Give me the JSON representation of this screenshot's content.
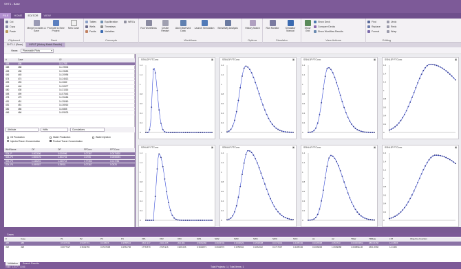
{
  "app": {
    "title": "SHT1 - Base"
  },
  "menu_tabs": [
    "FILE",
    "HOME",
    "EDITOR",
    "VIEW"
  ],
  "ribbon": {
    "clipboard": {
      "label": "Clipboard",
      "cut": "Cut",
      "copy": "Copy",
      "paste": "Paste"
    },
    "deck": {
      "label": "Deck",
      "merge": "Merge Includes & Save",
      "promote": "Promote to New Project",
      "new_case": "New Case"
    },
    "concepts": {
      "label": "Concepts",
      "tables": "Tables",
      "wells": "Wells",
      "faults": "Faults",
      "equilibration": "Equilibration",
      "timesteps": "Timesteps",
      "variables": "Variables",
      "wrcs": "WRCs"
    },
    "workflows": {
      "label": "Workflows",
      "run": "Run Workflows",
      "create": "Create Restart",
      "add_observed": "Add Observed Data",
      "launch": "Launch Simulation",
      "sensitivity": "Sensitivity Analysis"
    },
    "optima": {
      "label": "Optima",
      "history": "History Match"
    },
    "simulator": {
      "label": "Simulator",
      "run_monitor": "Run Monitor",
      "sim_manual": "Simulator Manual"
    },
    "view_actions": {
      "label": "View Actions",
      "show_grid": "Show Grid",
      "show_deck": "Show Deck",
      "compare": "Compare Decks",
      "show_results": "Show Workflow Results"
    },
    "editing": {
      "label": "Editing",
      "find": "Find",
      "replace": "Replace",
      "format": "Format",
      "undo": "Undo",
      "redo": "Redo",
      "wrap": "Wrap"
    }
  },
  "doc_tabs": [
    "SHT1-1 (Base)",
    "INPUT (History Match Results)"
  ],
  "views": {
    "label": "Views:",
    "value": "Plasmatch Plots"
  },
  "grid": {
    "headers": [
      "#",
      "Case",
      "Of"
    ],
    "rows": [
      [
        "498",
        "498",
        "14.4785"
      ],
      [
        "488",
        "488",
        "14.19506"
      ],
      [
        "498",
        "498",
        "14.19653"
      ],
      [
        "446",
        "445",
        "14.20996"
      ],
      [
        "474",
        "474",
        "14.24613"
      ],
      [
        "493",
        "493",
        "14.2682"
      ],
      [
        "446",
        "446",
        "14.30577"
      ],
      [
        "450",
        "430",
        "14.31316"
      ],
      [
        "498",
        "499",
        "14.57543"
      ],
      [
        "478",
        "479",
        "14.35486"
      ],
      [
        "451",
        "451",
        "14.35060"
      ],
      [
        "451",
        "451",
        "14.36916"
      ],
      [
        "486",
        "486",
        "14.5885"
      ],
      [
        "466",
        "466",
        "14.59003"
      ]
    ]
  },
  "filters": {
    "a": "Attribute",
    "b": "Hdfts",
    "c": "Cumulatives"
  },
  "checks": {
    "oil": "Oil Production",
    "water": "Water Production",
    "winj": "Water Injection",
    "inj_tracer": "Injected Tracer Concentration",
    "prod_tracer": "Product Tracer Concentration"
  },
  "wells": {
    "headers": [
      "Well Name",
      "OF",
      "OP",
      "FPConc",
      "FPTConc"
    ],
    "rows": [
      [
        "SDL-P",
        "0.002606",
        "0.006996",
        "0.07367",
        "0.0075520"
      ],
      [
        "SDL-P2",
        "1.000176",
        "1.402716",
        "1.0705",
        "0.0055094"
      ],
      [
        "SDL-P3",
        "1.448251",
        "1.445712",
        "1.77356",
        "0.017256"
      ],
      [
        "SDL-P4",
        "0.499557",
        "0.29901",
        "0.07367",
        "0.0025"
      ]
    ]
  },
  "plots": [
    {
      "title": "SSNL2P FTConc"
    },
    {
      "title": "SSNL3P FTConc"
    },
    {
      "title": "SSNL3P FTConc"
    },
    {
      "title": "SSNL3P FTConc"
    },
    {
      "title": "SSNL4P FTConc"
    },
    {
      "title": "SSNL4P FTConc"
    },
    {
      "title": "SSNL4P FTConc"
    },
    {
      "title": "SSNL3P FTConc"
    }
  ],
  "y_ticks_a": [
    "0",
    "0.2",
    "0.4",
    "0.6",
    "0.8",
    "1",
    "1.2",
    "1.4"
  ],
  "y_ticks_b": [
    "0",
    "0.2",
    "0.4",
    "0.6",
    "0.8",
    "1",
    "1.2",
    "1.4",
    "1.6"
  ],
  "cases": {
    "title": "Cases",
    "headers": [
      "#",
      "Case",
      "P1",
      "P2",
      "P3",
      "P4",
      "VP1",
      "VP2",
      "VP3",
      "SW1",
      "SW2",
      "SW3",
      "SW4",
      "SWC",
      "SOC",
      "A1",
      "A2",
      "TRatr",
      "TRRate",
      "LTZ",
      "Objective Function"
    ],
    "rows": [
      [
        "488",
        "488",
        "0.5467219",
        "0.5467719",
        "0.348526",
        "0.3589516",
        "1541.947",
        "2131.005",
        "202.001",
        "0.5961066",
        "0.0915743",
        "0.1546623",
        "0.1546668",
        "0.3171944",
        "0.4295182",
        "0.9026998",
        "2.654723",
        "0.000000052",
        "3864.5158",
        "14.19506"
      ],
      [
        "498",
        "498",
        "0.8077327",
        "0.3549783",
        "0.3547998",
        "0.2561706",
        "1778.879",
        "2745.916",
        "1966.006",
        "0.3902871",
        "0.0902572",
        "0.1556694",
        "0.1152022",
        "0.2717907",
        "0.4295182",
        "0.2009006",
        "1.0969988",
        "1.09086E-06",
        "2661.6666",
        "14.1966"
      ]
    ]
  },
  "status": {
    "tabs": [
      "Validation",
      "Search Results"
    ],
    "text": "Total Projects: 1 | Total Items: 1",
    "left": "valid: 1,017 / 1036"
  }
}
